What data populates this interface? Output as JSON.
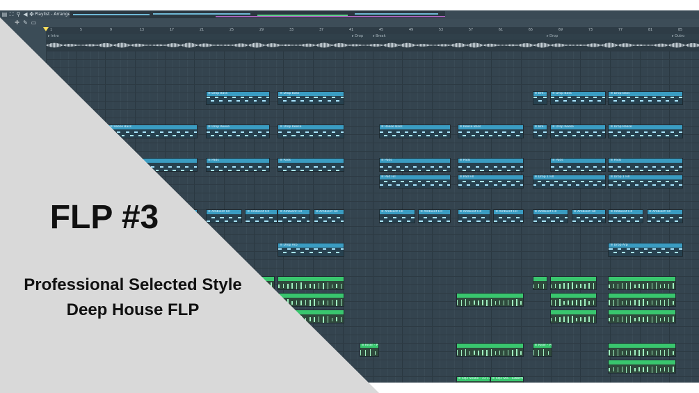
{
  "window": {
    "breadcrumb": "Playlist - Arrangement › TPS - Illusion - Atmosphere 01 C (124 BPM) ›"
  },
  "ruler": {
    "bar_labels": [
      "1",
      "5",
      "9",
      "13",
      "17",
      "21",
      "25",
      "29",
      "33",
      "37",
      "41",
      "45",
      "49",
      "53",
      "57",
      "61",
      "65",
      "69",
      "73",
      "77",
      "81",
      "85"
    ]
  },
  "markers": [
    "Intro",
    "Drop",
    "Break",
    "Drop",
    "Outro"
  ],
  "clips": [
    {
      "label": "Drop Bass",
      "row": 0,
      "start": 0.245,
      "end": 0.343,
      "color": "#3a9cc2"
    },
    {
      "label": "Drop Bass",
      "row": 0,
      "start": 0.355,
      "end": 0.457,
      "color": "#3a9cc2"
    },
    {
      "label": "Bre...ass",
      "row": 0,
      "start": 0.745,
      "end": 0.768,
      "color": "#3a9cc2"
    },
    {
      "label": "Drop Bass",
      "row": 0,
      "start": 0.772,
      "end": 0.857,
      "color": "#3a9cc2"
    },
    {
      "label": "Drop Bass",
      "row": 0,
      "start": 0.861,
      "end": 0.975,
      "color": "#3a9cc2"
    },
    {
      "label": "Reese Bass",
      "row": 1,
      "start": 0.095,
      "end": 0.232,
      "color": "#3a9cc2"
    },
    {
      "label": "Drop Reese",
      "row": 1,
      "start": 0.245,
      "end": 0.343,
      "color": "#3a9cc2"
    },
    {
      "label": "Drop Reese",
      "row": 1,
      "start": 0.355,
      "end": 0.457,
      "color": "#3a9cc2"
    },
    {
      "label": "Reese Bass",
      "row": 1,
      "start": 0.51,
      "end": 0.62,
      "color": "#3a9cc2"
    },
    {
      "label": "Reese Bass",
      "row": 1,
      "start": 0.63,
      "end": 0.732,
      "color": "#3a9cc2"
    },
    {
      "label": "Bre...ass",
      "row": 1,
      "start": 0.745,
      "end": 0.768,
      "color": "#3a9cc2"
    },
    {
      "label": "Drop Reese",
      "row": 1,
      "start": 0.772,
      "end": 0.857,
      "color": "#3a9cc2"
    },
    {
      "label": "Drop Reese",
      "row": 1,
      "start": 0.861,
      "end": 0.975,
      "color": "#3a9cc2"
    },
    {
      "label": "Pads",
      "row": 2,
      "start": 0.095,
      "end": 0.232,
      "color": "#3a9cc2"
    },
    {
      "label": "Pads",
      "row": 2,
      "start": 0.245,
      "end": 0.343,
      "color": "#3a9cc2"
    },
    {
      "label": "Pads",
      "row": 2,
      "start": 0.355,
      "end": 0.457,
      "color": "#3a9cc2"
    },
    {
      "label": "Pads",
      "row": 2,
      "start": 0.51,
      "end": 0.62,
      "color": "#3a9cc2"
    },
    {
      "label": "Pads",
      "row": 2,
      "start": 0.63,
      "end": 0.732,
      "color": "#3a9cc2"
    },
    {
      "label": "Pads",
      "row": 2,
      "start": 0.772,
      "end": 0.857,
      "color": "#3a9cc2"
    },
    {
      "label": "Pads",
      "row": 2,
      "start": 0.861,
      "end": 0.975,
      "color": "#3a9cc2"
    },
    {
      "label": "Pad Fill",
      "row": 3,
      "start": 0.51,
      "end": 0.62,
      "color": "#3a9cc2"
    },
    {
      "label": "Pad Fill",
      "row": 3,
      "start": 0.63,
      "end": 0.732,
      "color": "#3a9cc2"
    },
    {
      "label": "Drop 1 Fill",
      "row": 3,
      "start": 0.745,
      "end": 0.857,
      "color": "#3a9cc2"
    },
    {
      "label": "Drop 1 Fill",
      "row": 3,
      "start": 0.861,
      "end": 0.975,
      "color": "#3a9cc2"
    },
    {
      "label": "Ambient Fill",
      "row": 4,
      "start": 0.095,
      "end": 0.232,
      "color": "#3a9cc2"
    },
    {
      "label": "Ambient Fill",
      "row": 4,
      "start": 0.245,
      "end": 0.3,
      "color": "#3a9cc2"
    },
    {
      "label": "Ambient Fill",
      "row": 4,
      "start": 0.305,
      "end": 0.355,
      "color": "#3a9cc2"
    },
    {
      "label": "Ambient Fill",
      "row": 4,
      "start": 0.355,
      "end": 0.405,
      "color": "#3a9cc2"
    },
    {
      "label": "Ambient Fill",
      "row": 4,
      "start": 0.41,
      "end": 0.457,
      "color": "#3a9cc2"
    },
    {
      "label": "Ambient Fill",
      "row": 4,
      "start": 0.51,
      "end": 0.565,
      "color": "#3a9cc2"
    },
    {
      "label": "Ambient Fill",
      "row": 4,
      "start": 0.57,
      "end": 0.62,
      "color": "#3a9cc2"
    },
    {
      "label": "Ambient Fill",
      "row": 4,
      "start": 0.63,
      "end": 0.68,
      "color": "#3a9cc2"
    },
    {
      "label": "Ambient Fill",
      "row": 4,
      "start": 0.685,
      "end": 0.732,
      "color": "#3a9cc2"
    },
    {
      "label": "Ambient Fill",
      "row": 4,
      "start": 0.745,
      "end": 0.8,
      "color": "#3a9cc2"
    },
    {
      "label": "Ambient Fill",
      "row": 4,
      "start": 0.805,
      "end": 0.857,
      "color": "#3a9cc2"
    },
    {
      "label": "Ambient Fill",
      "row": 4,
      "start": 0.861,
      "end": 0.915,
      "color": "#3a9cc2"
    },
    {
      "label": "Ambient Fill",
      "row": 4,
      "start": 0.92,
      "end": 0.975,
      "color": "#3a9cc2"
    },
    {
      "label": "Drop Arp",
      "row": 5,
      "start": 0.355,
      "end": 0.457,
      "color": "#3a9cc2"
    },
    {
      "label": "Drop Arp",
      "row": 5,
      "start": 0.861,
      "end": 0.975,
      "color": "#3a9cc2"
    },
    {
      "label": "",
      "row": 6,
      "start": 0.31,
      "end": 0.35,
      "color": "#39c66e"
    },
    {
      "label": "",
      "row": 6,
      "start": 0.355,
      "end": 0.457,
      "color": "#39c66e"
    },
    {
      "label": "",
      "row": 6,
      "start": 0.745,
      "end": 0.768,
      "color": "#39c66e"
    },
    {
      "label": "",
      "row": 6,
      "start": 0.772,
      "end": 0.843,
      "color": "#39c66e"
    },
    {
      "label": "",
      "row": 6,
      "start": 0.861,
      "end": 0.965,
      "color": "#39c66e"
    },
    {
      "label": "",
      "row": 7,
      "start": 0.355,
      "end": 0.457,
      "color": "#39c66e"
    },
    {
      "label": "",
      "row": 7,
      "start": 0.628,
      "end": 0.732,
      "color": "#39c66e"
    },
    {
      "label": "",
      "row": 7,
      "start": 0.772,
      "end": 0.843,
      "color": "#39c66e"
    },
    {
      "label": "",
      "row": 7,
      "start": 0.861,
      "end": 0.965,
      "color": "#39c66e"
    },
    {
      "label": "",
      "row": 8,
      "start": 0.355,
      "end": 0.457,
      "color": "#39c66e"
    },
    {
      "label": "",
      "row": 8,
      "start": 0.772,
      "end": 0.843,
      "color": "#39c66e"
    },
    {
      "label": "",
      "row": 8,
      "start": 0.861,
      "end": 0.965,
      "color": "#39c66e"
    },
    {
      "label": "Riser - Pul",
      "row": 9,
      "start": 0.48,
      "end": 0.51,
      "color": "#39c66e"
    },
    {
      "label": "",
      "row": 9,
      "start": 0.628,
      "end": 0.732,
      "color": "#39c66e"
    },
    {
      "label": "Riser - Pl",
      "row": 9,
      "start": 0.745,
      "end": 0.775,
      "color": "#39c66e"
    },
    {
      "label": "",
      "row": 9,
      "start": 0.861,
      "end": 0.965,
      "color": "#39c66e"
    },
    {
      "label": "",
      "row": 10,
      "start": 0.861,
      "end": 0.965,
      "color": "#39c66e"
    },
    {
      "label": "SQ2 Snake - 33 128BPM",
      "row": 11,
      "start": 0.628,
      "end": 0.68,
      "color": "#39c66e"
    },
    {
      "label": "SQ2 Sta...128BPM",
      "row": 11,
      "start": 0.68,
      "end": 0.732,
      "color": "#39c66e"
    }
  ],
  "overlay": {
    "heading": "FLP #3",
    "subtitle_line1": "Professional Selected Style",
    "subtitle_line2": "Deep House FLP",
    "triangle_color": "#d9d9d9"
  }
}
